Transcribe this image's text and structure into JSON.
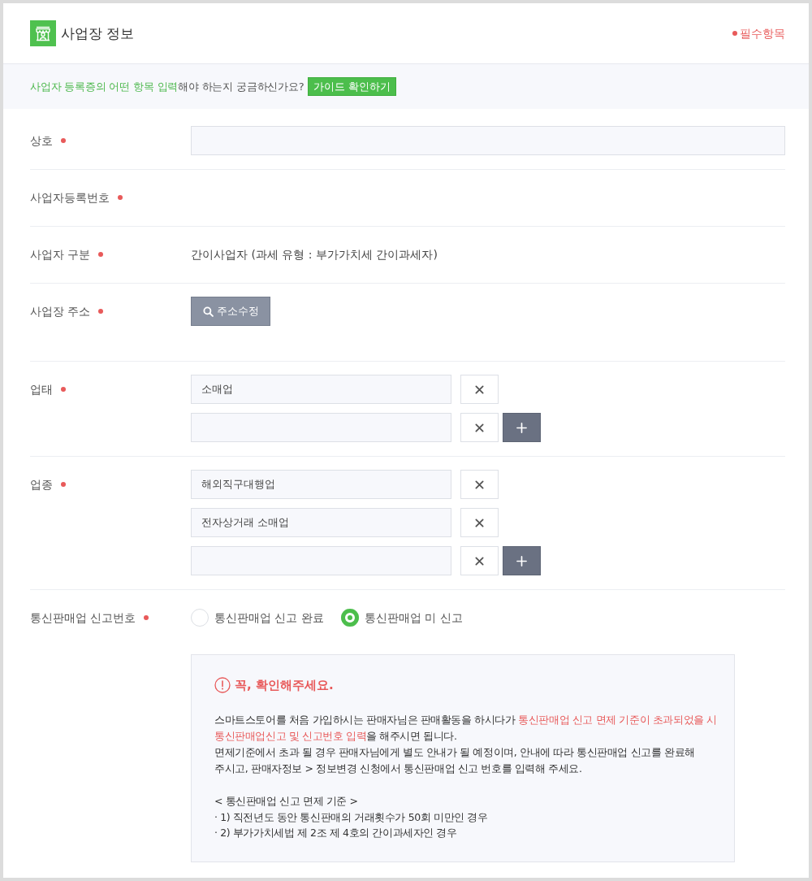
{
  "header": {
    "title": "사업장 정보",
    "required_legend": "필수항목"
  },
  "guide": {
    "segments": [
      {
        "text": "사업자 등록증의 어떤 항목 입력",
        "highlight": true
      },
      {
        "text": "해야 하는지 궁금하신가요?",
        "highlight": false
      }
    ],
    "button": "가이드 확인하기"
  },
  "fields": [
    {
      "kind": "input",
      "label": "상호",
      "required": true
    },
    {
      "kind": "text",
      "label": "사업자등록번호",
      "required": true
    },
    {
      "kind": "text",
      "label": "사업자 구분",
      "required": true,
      "value": "간이사업자 (과세 유형 : 부가가치세 간이과세자)"
    },
    {
      "kind": "button",
      "label": "사업장 주소",
      "required": true,
      "button": "주소수정"
    },
    {
      "kind": "list",
      "label": "업태",
      "required": true,
      "entries": [
        {
          "value": "소매업",
          "add": false
        },
        {
          "add": true
        }
      ]
    },
    {
      "kind": "list",
      "label": "업종",
      "required": true,
      "entries": [
        {
          "value": "해외직구대행업",
          "add": false
        },
        {
          "value": "전자상거래 소매업",
          "add": false
        },
        {
          "add": true
        }
      ]
    },
    {
      "kind": "radio",
      "label": "통신판매업 신고번호",
      "required": true,
      "options": [
        {
          "label": "통신판매업 신고 완료",
          "selected": false
        },
        {
          "label": "통신판매업 미 신고",
          "selected": true
        }
      ],
      "notice": {
        "title": "꼭, 확인해주세요.",
        "paragraphs": [
          [
            {
              "text": "스마트스토어를 처음 가입하시는 판매자님은 판매활동을 하시다가 ",
              "highlight": false
            },
            {
              "text": "통신판매업 신고 면제 기준이 초과되었을 시 통신판매업신고 및 신고번호 입력",
              "highlight": true
            },
            {
              "text": "을 해주시면 됩니다.",
              "highlight": false
            }
          ],
          [
            {
              "text": "면제기준에서 초과 될 경우 판매자님에게 별도 안내가 될 예정이며, 안내에 따라 통신판매업 신고를 완료해 주시고, 판매자정보 > 정보변경 신청에서 통신판매업 신고 번호를 입력해 주세요.",
              "highlight": false
            }
          ]
        ],
        "criteria_title": "< 통신판매업 신고 면제 기준 >",
        "criteria": [
          "· 1) 직전년도 동안 통신판매의 거래횟수가 50회 미만인 경우",
          "· 2) 부가가치세법 제 2조 제 4호의 간이과세자인 경우"
        ]
      }
    }
  ]
}
